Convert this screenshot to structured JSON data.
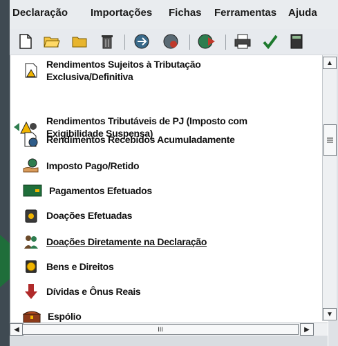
{
  "menu": [
    {
      "label": "Declaração"
    },
    {
      "label": "Importações"
    },
    {
      "label": "Fichas"
    },
    {
      "label": "Ferramentas"
    },
    {
      "label": "Ajuda"
    }
  ],
  "toolbar": {
    "icons": [
      "new-document-icon",
      "open-folder-icon",
      "folder-icon",
      "trash-icon",
      "transmit-icon",
      "receive-icon",
      "globe-icon",
      "print-icon",
      "check-icon",
      "calculator-icon"
    ]
  },
  "list": {
    "items": [
      {
        "line1": "Rendimentos Sujeitos à Tributação",
        "line2": "Exclusiva/Definitiva",
        "icon": "document-warning-icon"
      },
      {
        "line1": "Rendimentos Tributáveis de PJ (Imposto com",
        "line2": "Exigibilidade Suspensa)",
        "icon": "people-arrows-icon"
      },
      {
        "line1": "Rendimentos Recebidos Acumuladamente",
        "icon": "document-clock-icon"
      },
      {
        "line1": "Imposto Pago/Retido",
        "icon": "hand-money-icon"
      },
      {
        "line1": "Pagamentos Efetuados",
        "icon": "banknote-icon"
      },
      {
        "line1": "Doações Efetuadas",
        "icon": "money-jar-icon"
      },
      {
        "line1": "Doações Diretamente na Declaração",
        "icon": "person-group-icon"
      },
      {
        "line1": "Bens e Direitos",
        "icon": "coin-document-icon"
      },
      {
        "line1": "Dívidas e Ônus Reais",
        "icon": "down-arrow-icon"
      },
      {
        "line1": "Espólio",
        "icon": "treasure-chest-icon"
      }
    ]
  },
  "scroll": {
    "h_thumb_label": "III"
  },
  "colors": {
    "accent_arrow": "#1f6e3a"
  }
}
